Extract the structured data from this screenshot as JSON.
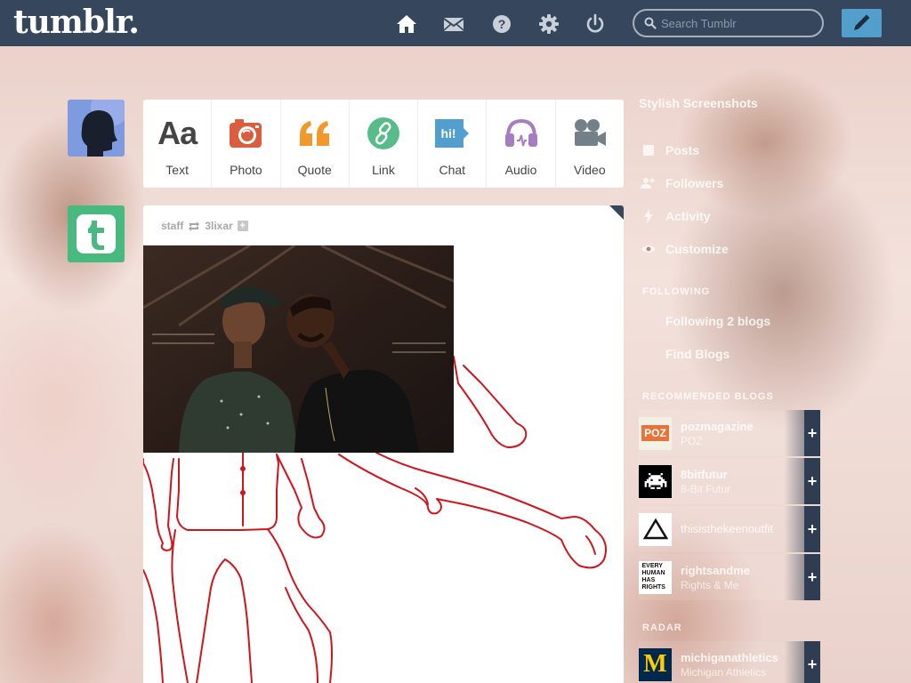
{
  "header": {
    "logo": "tumblr.",
    "search": {
      "placeholder": "Search Tumblr",
      "value": ""
    },
    "icons": [
      "home-icon",
      "inbox-icon",
      "help-icon",
      "settings-icon",
      "logout-icon",
      "compose-icon"
    ]
  },
  "post_types": [
    {
      "label": "Text",
      "icon": "text-icon",
      "color": "#444444"
    },
    {
      "label": "Photo",
      "icon": "camera-icon",
      "color": "#d95e40"
    },
    {
      "label": "Quote",
      "icon": "quote-icon",
      "color": "#f2992e"
    },
    {
      "label": "Link",
      "icon": "link-icon",
      "color": "#56bc8a"
    },
    {
      "label": "Chat",
      "icon": "chat-icon",
      "color": "#529ecc"
    },
    {
      "label": "Audio",
      "icon": "headphones-icon",
      "color": "#a77dc2"
    },
    {
      "label": "Video",
      "icon": "video-camera-icon",
      "color": "#748089"
    }
  ],
  "post": {
    "author": "staff",
    "reblogged_from": "3lixar"
  },
  "sidebar": {
    "blog_title": "Stylish Screenshots",
    "items": [
      {
        "label": "Posts",
        "icon": "posts-icon"
      },
      {
        "label": "Followers",
        "icon": "followers-icon"
      },
      {
        "label": "Activity",
        "icon": "activity-icon"
      },
      {
        "label": "Customize",
        "icon": "eye-icon"
      }
    ],
    "following_heading": "FOLLOWING",
    "following_items": [
      {
        "label": "Following 2 blogs",
        "icon": "following-icon"
      },
      {
        "label": "Find Blogs",
        "icon": "compass-icon"
      }
    ],
    "recommended_heading": "RECOMMENDED BLOGS",
    "recommended": [
      {
        "name": "pozmagazine",
        "subtitle": "POZ",
        "avatar_text": "POZ"
      },
      {
        "name": "8bitfutur",
        "subtitle": "8-Bit Futur",
        "avatar_text": ""
      },
      {
        "name": "thisisthekeenoutfit",
        "subtitle": "",
        "avatar_text": ""
      },
      {
        "name": "rightsandme",
        "subtitle": "Rights & Me",
        "avatar_text": "EVERY HUMAN HAS RIGHTS"
      }
    ],
    "radar_heading": "RADAR",
    "radar": {
      "name": "michiganathletics",
      "subtitle": "Michigan Athletics",
      "avatar_text": "M"
    },
    "follow_label": "+"
  },
  "colors": {
    "header_bg": "#36465d",
    "compose_bg": "#529ecc",
    "drawing_stroke": "#d0141c"
  }
}
